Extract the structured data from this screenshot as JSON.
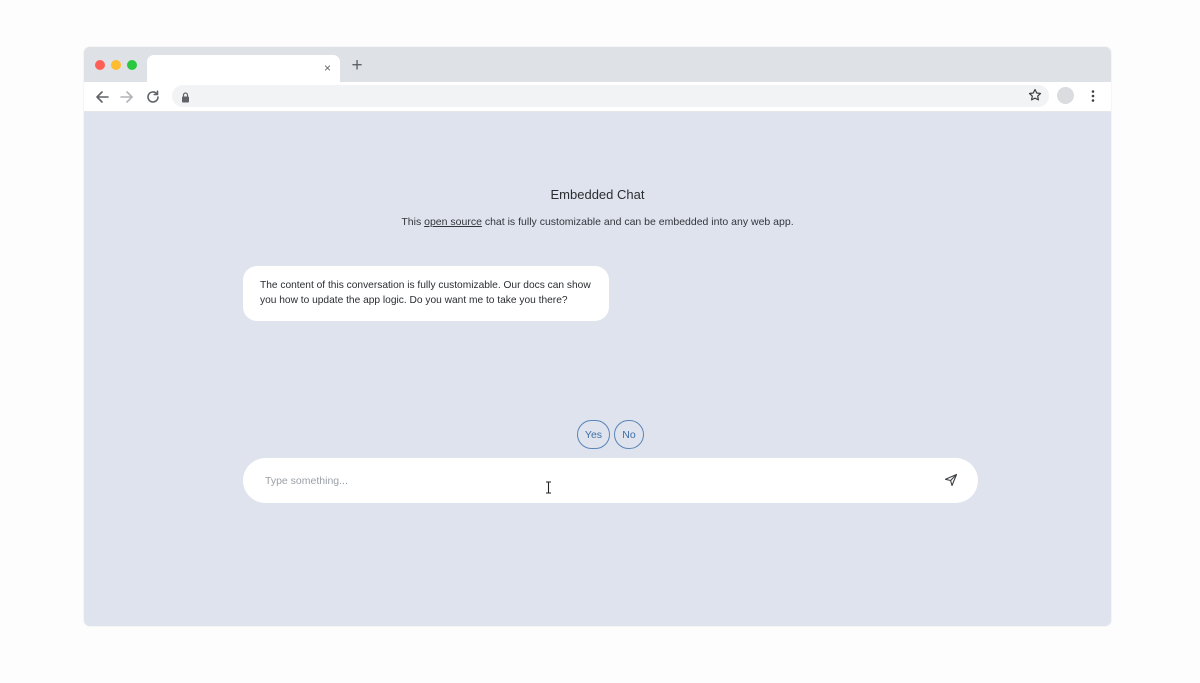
{
  "browser": {
    "tab_close_glyph": "×",
    "new_tab_glyph": "+",
    "colors": {
      "traffic_red": "#fe5f57",
      "traffic_yellow": "#febc2e",
      "traffic_green": "#28c840",
      "page_background": "#dee3ed",
      "accent": "#3f6fa6"
    },
    "icons": [
      "back-arrow-icon",
      "forward-arrow-icon",
      "reload-icon",
      "lock-icon",
      "bookmark-star-icon",
      "profile-avatar",
      "more-menu-icon"
    ]
  },
  "page": {
    "title": "Embedded Chat",
    "subtitle_prefix": "This ",
    "subtitle_link": "open source",
    "subtitle_suffix": " chat is fully customizable and can be embedded into any web app."
  },
  "chat": {
    "messages": [
      {
        "sender": "bot",
        "text": "The content of this conversation is fully customizable. Our docs can show you how to update the app logic. Do you want me to take you there?"
      }
    ],
    "choices": [
      "Yes",
      "No"
    ],
    "input": {
      "value": "",
      "placeholder": "Type something..."
    },
    "send_icon": "send-icon"
  }
}
